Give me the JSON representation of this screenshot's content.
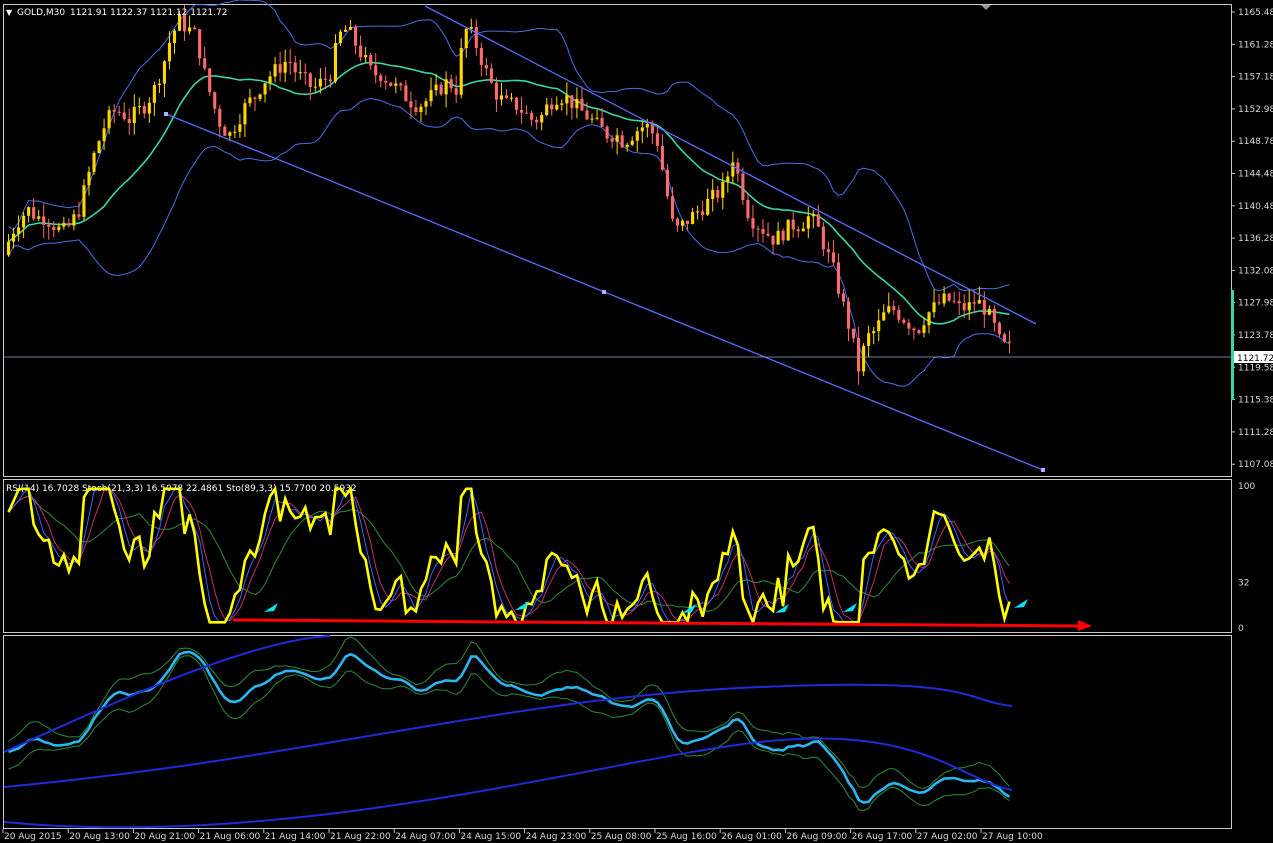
{
  "header": {
    "symbol": "GOLD,M30",
    "ohlc": "1121.91 1122.37 1121.12 1121.72"
  },
  "indicator_header": "RSI(14) 16.7028  Stoch(21,3,3) 16.5078 22.4861  Sto(89,3,3) 15.7700 20.5932",
  "price_axis": {
    "ticks": [
      "1165.48",
      "1161.28",
      "1157.18",
      "1152.98",
      "1148.78",
      "1144.48",
      "1140.48",
      "1136.28",
      "1132.08",
      "1127.98",
      "1123.78",
      "1119.58",
      "1115.38",
      "1111.28",
      "1107.08"
    ],
    "current_price": "1121.72"
  },
  "osc_axis": {
    "ticks": [
      "100",
      "32",
      "0"
    ]
  },
  "time_axis": {
    "ticks": [
      "20 Aug 2015",
      "20 Aug 13:00",
      "20 Aug 21:00",
      "21 Aug 06:00",
      "21 Aug 14:00",
      "21 Aug 22:00",
      "24 Aug 07:00",
      "24 Aug 15:00",
      "24 Aug 23:00",
      "25 Aug 08:00",
      "25 Aug 16:00",
      "26 Aug 01:00",
      "26 Aug 09:00",
      "26 Aug 17:00",
      "27 Aug 02:00",
      "27 Aug 10:00"
    ]
  },
  "colors": {
    "background": "#000000",
    "bull_candle": "#ffd700",
    "bear_candle": "#ff6a6a",
    "bollinger": "#4a6fe8",
    "ma": "#3ad6a8",
    "trendline": "#5a6cff",
    "rsi": "#ffff00",
    "support_arrow": "#ff0000",
    "cyan_arrow": "#00e5ff"
  },
  "chart_data": {
    "type": "candlestick",
    "title": "GOLD,M30",
    "ylim": [
      1105,
      1167
    ],
    "price_path": [
      1134,
      1137,
      1139,
      1140,
      1139,
      1139,
      1138,
      1137,
      1138,
      1140,
      1144,
      1148,
      1151,
      1153,
      1153,
      1152,
      1153,
      1154,
      1156,
      1159,
      1163,
      1165,
      1164,
      1163,
      1158,
      1154,
      1151,
      1150,
      1152,
      1154,
      1155,
      1157,
      1158,
      1159,
      1160,
      1158,
      1157,
      1156,
      1157,
      1158,
      1163,
      1164,
      1162,
      1160,
      1158,
      1158,
      1157,
      1156,
      1155,
      1154,
      1154,
      1155,
      1156,
      1157,
      1156,
      1164,
      1163,
      1160,
      1157,
      1155,
      1154,
      1154,
      1153,
      1152,
      1152,
      1154,
      1155,
      1155,
      1154,
      1153,
      1152,
      1151,
      1150,
      1150,
      1149,
      1150,
      1151,
      1151,
      1149,
      1143,
      1137,
      1138,
      1139,
      1140,
      1141,
      1142,
      1143,
      1147,
      1143,
      1139,
      1138,
      1137,
      1136,
      1137,
      1138,
      1138,
      1139,
      1138,
      1135,
      1132,
      1128,
      1124,
      1119,
      1123,
      1124,
      1126,
      1127,
      1126,
      1125,
      1124,
      1126,
      1127,
      1128,
      1128,
      1127,
      1127,
      1128,
      1127,
      1125,
      1122,
      1121.7
    ]
  }
}
